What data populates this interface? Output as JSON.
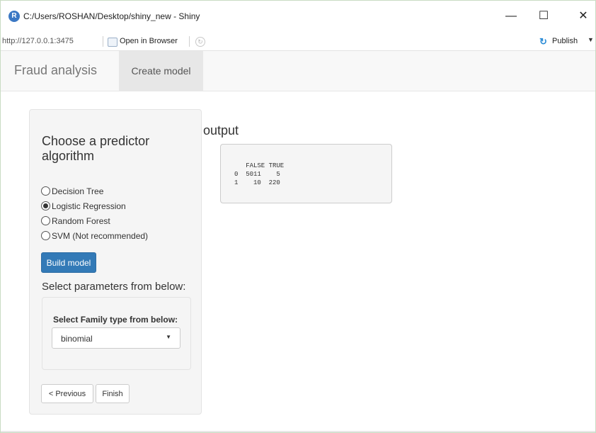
{
  "window": {
    "title": "C:/Users/ROSHAN/Desktop/shiny_new - Shiny",
    "minimize": "—",
    "maximize": "☐",
    "close": "✕"
  },
  "toolbar": {
    "url": "http://127.0.0.1:3475",
    "open_in_browser": "Open in Browser",
    "publish": "Publish"
  },
  "navbar": {
    "brand": "Fraud analysis",
    "tabs": [
      {
        "label": "Create model",
        "active": true
      }
    ]
  },
  "sidebar": {
    "title": "Choose a predictor algorithm",
    "options": [
      {
        "label": "Decision Tree",
        "checked": false
      },
      {
        "label": "Logistic Regression",
        "checked": true
      },
      {
        "label": "Random Forest",
        "checked": false
      },
      {
        "label": "SVM (Not recommended)",
        "checked": false
      }
    ],
    "build_label": "Build model",
    "params_label": "Select parameters from below:",
    "family_label": "Select Family type from below:",
    "family_value": "binomial",
    "prev_label": "< Previous",
    "finish_label": "Finish"
  },
  "output": {
    "title": "output",
    "table": "   FALSE TRUE\n0  5011    5\n1    10  220"
  },
  "colors": {
    "accent": "#337ab7",
    "navbar_bg": "#f8f8f8",
    "active_tab_bg": "#e7e7e7"
  }
}
